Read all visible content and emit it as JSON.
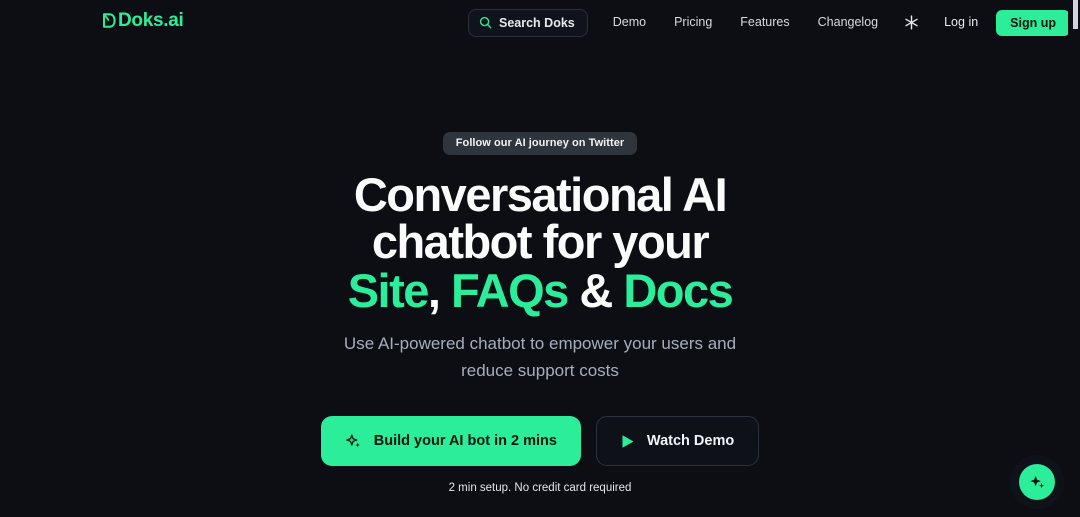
{
  "brand": {
    "logo_text": "Doks.ai",
    "logo_icon": "doks-d-mark-icon",
    "accent_color": "#2bed9a",
    "background_color": "#0c0e14"
  },
  "header": {
    "search": {
      "label": "Search Doks",
      "icon": "search-icon"
    },
    "nav_links": [
      {
        "label": "Demo"
      },
      {
        "label": "Pricing"
      },
      {
        "label": "Features"
      },
      {
        "label": "Changelog"
      }
    ],
    "theme_toggle": {
      "icon": "sun-icon"
    },
    "login_label": "Log in",
    "signup_label": "Sign up"
  },
  "hero": {
    "badge": "Follow our AI journey on Twitter",
    "headline": {
      "line1": "Conversational AI",
      "line2": "chatbot for your",
      "line3_part1": "Site",
      "line3_sep1": ",",
      "line3_part2": "FAQs",
      "line3_sep2": "&",
      "line3_part3": "Docs"
    },
    "subtitle": "Use AI-powered chatbot to empower your users and reduce support costs",
    "cta_primary": {
      "label": "Build your AI bot in 2 mins",
      "icon": "sparkle-icon"
    },
    "cta_secondary": {
      "label": "Watch Demo",
      "icon": "play-icon"
    },
    "footnote": "2 min setup. No credit card required"
  },
  "chat_widget": {
    "icon": "sparkle-icon",
    "color": "#2bed9a"
  }
}
